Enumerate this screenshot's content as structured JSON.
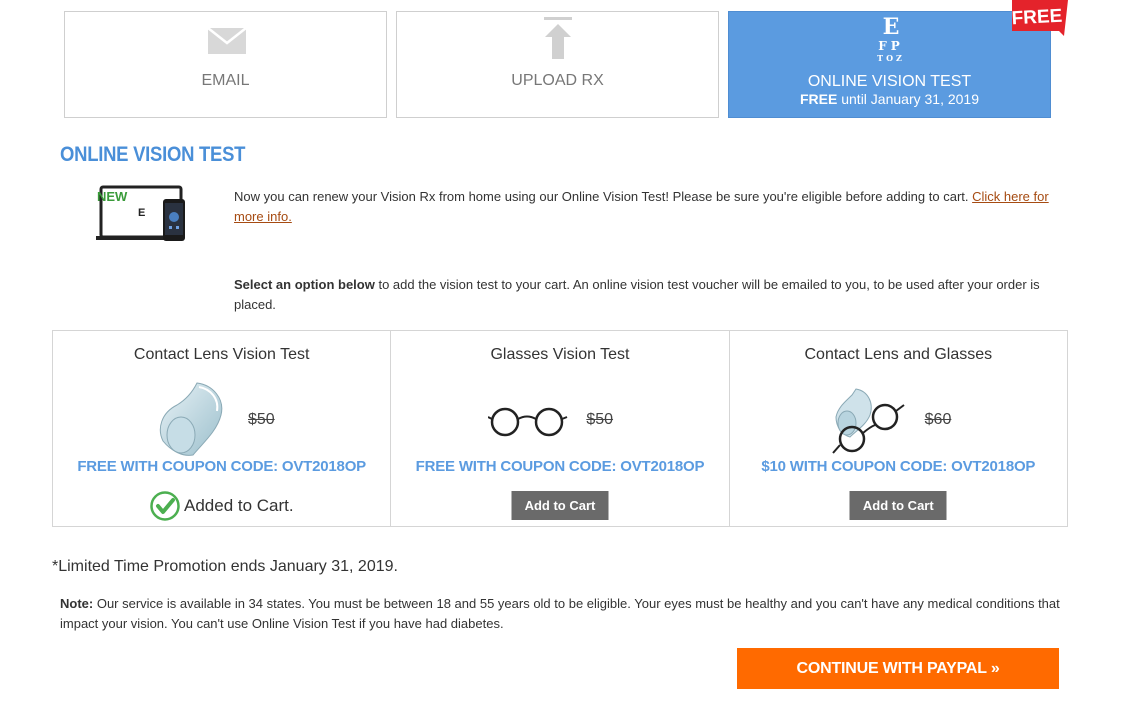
{
  "tiles": {
    "email": {
      "label": "EMAIL"
    },
    "upload": {
      "label": "UPLOAD RX"
    },
    "vision": {
      "label": "ONLINE VISION TEST",
      "sub_bold": "FREE",
      "sub_rest": " until January 31, 2019",
      "chart_rows": [
        "E",
        "FP",
        "TOZ"
      ]
    }
  },
  "badge": {
    "text": "FREE",
    "color": "#e4232b"
  },
  "section_title": "ONLINE VISION TEST",
  "device": {
    "new_label": "NEW",
    "screen_letter": "E"
  },
  "intro": {
    "text": "Now you can renew your Vision Rx from home using our Online Vision Test! Please be sure you're eligible before adding to cart. ",
    "link": "Click here for more info."
  },
  "select_note": {
    "bold": "Select an option below",
    "rest": " to add the vision test to your cart. An online vision test voucher will be emailed to you, to be used after your order is placed."
  },
  "products": [
    {
      "title": "Contact Lens Vision Test",
      "price": "$50",
      "coupon": "FREE WITH COUPON CODE: OVT2018OP",
      "status": "Added to Cart."
    },
    {
      "title": "Glasses Vision Test",
      "price": "$50",
      "coupon": "FREE WITH COUPON CODE: OVT2018OP",
      "button": "Add to Cart"
    },
    {
      "title": "Contact Lens and Glasses",
      "price": "$60",
      "coupon": "$10 WITH COUPON CODE: OVT2018OP",
      "button": "Add to Cart"
    }
  ],
  "promo": "*Limited Time Promotion ends January 31, 2019.",
  "note": {
    "bold": "Note:",
    "rest": " Our service is available in 34 states. You must be between 18 and 55 years old to be eligible. Your eyes must be healthy and you can't have any medical conditions that impact your vision. You can't use Online Vision Test if you have had diabetes."
  },
  "paypal_button": "CONTINUE WITH PAYPAL »",
  "colors": {
    "accent": "#5b9be0",
    "title_blue": "#4a8fd8",
    "paypal_orange": "#ff6a00",
    "check_green": "#4caf50"
  }
}
